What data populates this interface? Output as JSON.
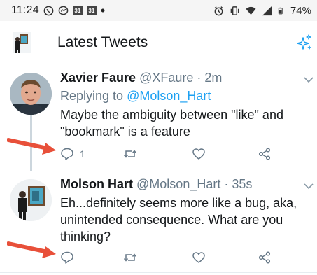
{
  "status_bar": {
    "time": "11:24",
    "calendar_day_1": "31",
    "calendar_day_2": "31",
    "battery": "74%"
  },
  "header": {
    "title": "Latest Tweets"
  },
  "tweets": [
    {
      "name": "Xavier Faure",
      "handle": "@XFaure",
      "separator": "·",
      "age": "2m",
      "replying_prefix": "Replying to",
      "replying_to": "@Molson_Hart",
      "text_line1": "Maybe the ambiguity between \"like\" and",
      "text_line2": "\"bookmark\" is a feature",
      "reply_count": "1"
    },
    {
      "name": "Molson Hart",
      "handle": "@Molson_Hart",
      "separator": "·",
      "age": "35s",
      "text_line1": "Eh...definitely seems more like a bug, aka,",
      "text_line2": "unintended consequence. What are you",
      "text_line3": "thinking?",
      "reply_count": ""
    }
  ],
  "colors": {
    "accent": "#1da1f2",
    "secondary_text": "#657786",
    "arrow": "#e8503a"
  },
  "icons": [
    "whatsapp-icon",
    "messenger-icon",
    "calendar-icon",
    "alarm-icon",
    "vibrate-icon",
    "wifi-icon",
    "signal-icon",
    "battery-icon",
    "sparkle-icon",
    "chevron-down-icon",
    "reply-icon",
    "retweet-icon",
    "like-icon",
    "share-icon",
    "red-arrow-annotation"
  ]
}
